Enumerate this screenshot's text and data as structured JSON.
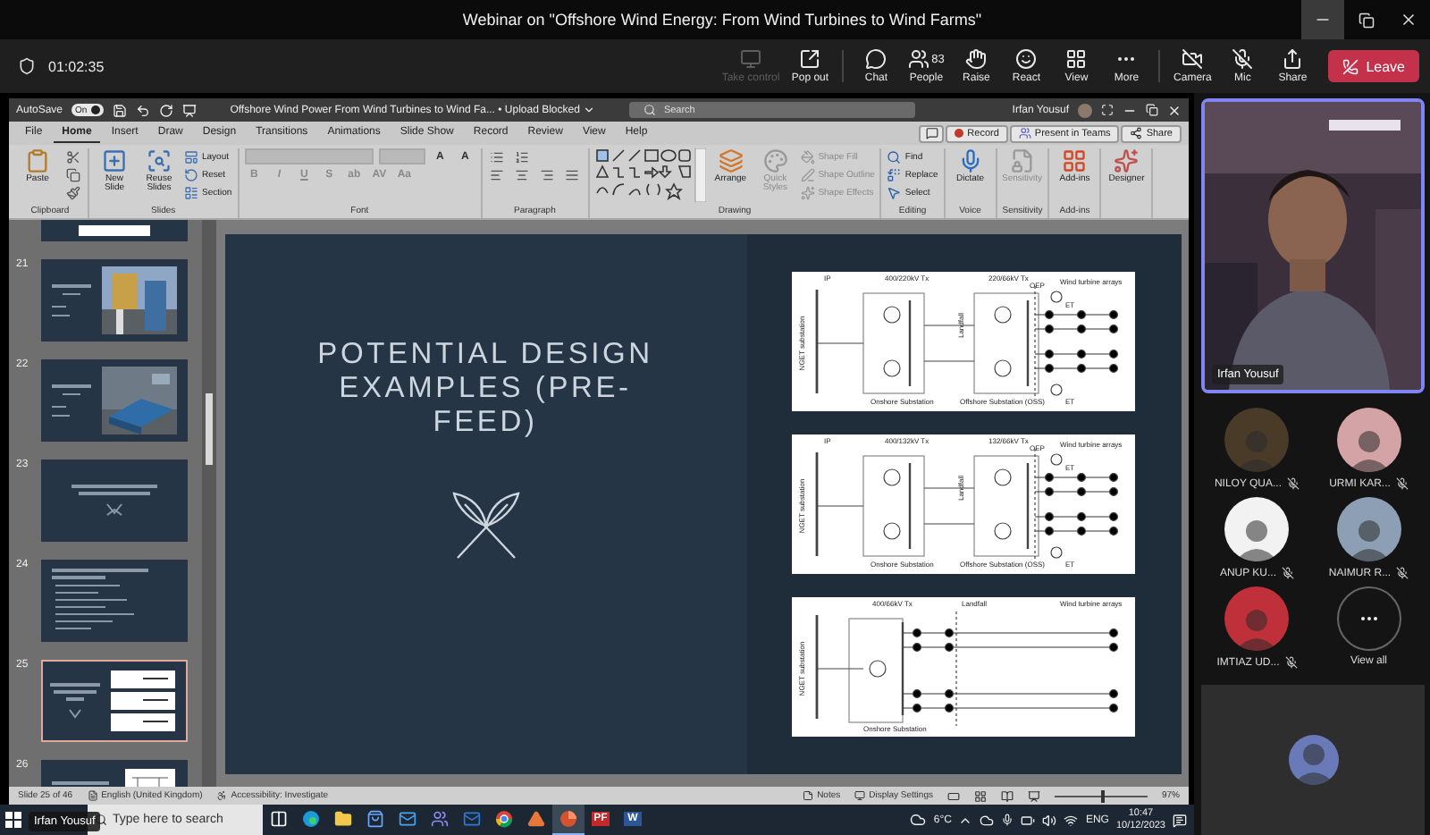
{
  "meeting": {
    "title": "Webinar on \"Offshore Wind Energy: From Wind Turbines to Wind Farms\"",
    "timer": "01:02:35",
    "controls": [
      {
        "label": "Take control",
        "kind": "take-control",
        "disabled": true
      },
      {
        "label": "Pop out",
        "kind": "pop-out",
        "disabled": false
      },
      {
        "label": "Chat",
        "kind": "chat",
        "disabled": false
      },
      {
        "label": "People",
        "kind": "people",
        "disabled": false,
        "count": "83"
      },
      {
        "label": "Raise",
        "kind": "raise",
        "disabled": false
      },
      {
        "label": "React",
        "kind": "react",
        "disabled": false
      },
      {
        "label": "View",
        "kind": "view",
        "disabled": false
      },
      {
        "label": "More",
        "kind": "more",
        "disabled": false
      },
      {
        "label": "Camera",
        "kind": "camera",
        "disabled": false,
        "on": false
      },
      {
        "label": "Mic",
        "kind": "mic",
        "disabled": false,
        "on": false
      },
      {
        "label": "Share",
        "kind": "share",
        "disabled": false
      }
    ],
    "leave": "Leave"
  },
  "powerpoint": {
    "autosave": {
      "label": "AutoSave",
      "state": "On",
      "on": true
    },
    "file_title": "Offshore Wind Power From Wind Turbines to Wind Fa... • Upload Blocked",
    "search": {
      "placeholder": "Search"
    },
    "user": "Irfan Yousuf",
    "tabs": [
      {
        "label": "File",
        "selected": false
      },
      {
        "label": "Home",
        "selected": true
      },
      {
        "label": "Insert",
        "selected": false
      },
      {
        "label": "Draw",
        "selected": false
      },
      {
        "label": "Design",
        "selected": false
      },
      {
        "label": "Transitions",
        "selected": false
      },
      {
        "label": "Animations",
        "selected": false
      },
      {
        "label": "Slide Show",
        "selected": false
      },
      {
        "label": "Record",
        "selected": false
      },
      {
        "label": "Review",
        "selected": false
      },
      {
        "label": "View",
        "selected": false
      },
      {
        "label": "Help",
        "selected": false
      }
    ],
    "header_buttons": [
      "Record",
      "Present in Teams",
      "Share"
    ],
    "ribbon": [
      {
        "kind": "clipboard",
        "name": "Clipboard",
        "items": [
          {
            "label": "Paste",
            "kind": "large",
            "disabled": false
          }
        ]
      },
      {
        "kind": "slides",
        "name": "Slides",
        "items": [
          {
            "label": "New Slide",
            "kind": "large",
            "disabled": false
          },
          {
            "label": "Reuse Slides",
            "kind": "large",
            "disabled": false
          },
          {
            "label": "Layout",
            "kind": "small",
            "disabled": false
          },
          {
            "label": "Reset",
            "kind": "small",
            "disabled": false
          },
          {
            "label": "Section",
            "kind": "small",
            "disabled": false
          }
        ]
      },
      {
        "kind": "font",
        "name": "Font",
        "items": [
          {
            "label": "B",
            "kind": "format",
            "disabled": true
          },
          {
            "label": "I",
            "kind": "format",
            "disabled": true
          },
          {
            "label": "U",
            "kind": "format",
            "disabled": true
          },
          {
            "label": "S",
            "kind": "format",
            "disabled": true
          },
          {
            "label": "ab",
            "kind": "format",
            "disabled": true
          },
          {
            "label": "AV",
            "kind": "format",
            "disabled": true
          },
          {
            "label": "Aa",
            "kind": "format",
            "disabled": true
          },
          {
            "label": "A",
            "kind": "format",
            "disabled": false
          },
          {
            "label": "A",
            "kind": "format",
            "disabled": false
          }
        ]
      },
      {
        "kind": "paragraph",
        "name": "Paragraph"
      },
      {
        "kind": "drawing",
        "name": "Drawing",
        "items": [
          {
            "label": "Arrange",
            "kind": "large",
            "disabled": false
          },
          {
            "label": "Quick Styles",
            "kind": "large",
            "disabled": true
          },
          {
            "label": "Shape Fill",
            "kind": "small",
            "disabled": true
          },
          {
            "label": "Shape Outline",
            "kind": "small",
            "disabled": true
          },
          {
            "label": "Shape Effects",
            "kind": "small",
            "disabled": true
          }
        ]
      },
      {
        "kind": "editing",
        "name": "Editing",
        "items": [
          {
            "label": "Find",
            "kind": "small",
            "disabled": false
          },
          {
            "label": "Replace",
            "kind": "small",
            "disabled": false
          },
          {
            "label": "Select",
            "kind": "small",
            "disabled": false
          }
        ]
      },
      {
        "kind": "voice",
        "name": "Voice",
        "items": [
          {
            "label": "Dictate",
            "kind": "large",
            "disabled": false
          }
        ]
      },
      {
        "kind": "sensitivity",
        "name": "Sensitivity",
        "items": [
          {
            "label": "Sensitivity",
            "kind": "large",
            "disabled": true
          }
        ]
      },
      {
        "kind": "addins",
        "name": "Add-ins",
        "items": [
          {
            "label": "Add-ins",
            "kind": "large",
            "disabled": false
          }
        ]
      },
      {
        "kind": "designer",
        "items": [
          {
            "label": "Designer",
            "kind": "large",
            "disabled": false
          }
        ]
      }
    ],
    "thumbnails": [
      {
        "kind": "cut-off",
        "selected": false
      },
      {
        "number": "21",
        "selected": false
      },
      {
        "number": "22",
        "selected": false
      },
      {
        "number": "23",
        "kind": "title",
        "selected": false
      },
      {
        "number": "24",
        "kind": "list",
        "selected": false
      },
      {
        "number": "25",
        "kind": "diagrams",
        "selected": true
      },
      {
        "number": "26",
        "kind": "text-diagram",
        "selected": false
      }
    ],
    "slide": {
      "title": "POTENTIAL DESIGN EXAMPLES (PRE-FEED)",
      "diagrams": [
        {
          "kind": "two-substation",
          "labels": [
            "IP",
            "400/220kV Tx",
            "220/66kV Tx",
            "OEP",
            "Wind turbine arrays",
            "ET",
            "Landfall",
            "NGET substation",
            "Onshore Substation",
            "Offshore Substation (OSS)",
            "ET"
          ]
        },
        {
          "kind": "two-substation",
          "labels": [
            "IP",
            "400/132kV Tx",
            "132/66kV Tx",
            "OEP",
            "Wind turbine arrays",
            "ET",
            "Landfall",
            "NGET substation",
            "Onshore Substation",
            "Offshore Substation (OSS)",
            "ET"
          ]
        },
        {
          "kind": "landfall",
          "labels": [
            "400/66kV Tx",
            "Landfall",
            "Wind turbine arrays",
            "NGET substation",
            "Onshore Substation"
          ]
        }
      ]
    },
    "status_bar": {
      "slide": "Slide 25 of 46",
      "language": "English (United Kingdom)",
      "accessibility": "Accessibility: Investigate",
      "notes": "Notes",
      "display": "Display Settings",
      "zoom": {
        "label": "97%",
        "level": 0.5
      }
    }
  },
  "presenter_label": "Irfan Yousuf",
  "taskbar": {
    "search": {
      "placeholder": "Type here to search"
    },
    "apps": [
      {
        "kind": "task-view",
        "active": false
      },
      {
        "kind": "edge",
        "active": false
      },
      {
        "kind": "explorer",
        "active": false
      },
      {
        "kind": "store",
        "active": false
      },
      {
        "kind": "mail",
        "active": false
      },
      {
        "kind": "teams",
        "active": false
      },
      {
        "kind": "outlook",
        "active": false
      },
      {
        "kind": "chrome",
        "active": false
      },
      {
        "kind": "matlab",
        "active": false
      },
      {
        "kind": "powerpoint",
        "active": true
      },
      {
        "kind": "pdf",
        "active": false,
        "glyph": "PF"
      },
      {
        "kind": "word",
        "active": false,
        "glyph": "W"
      }
    ],
    "temperature": "6°C",
    "language": "ENG",
    "time": "10:47",
    "date": "10/12/2023"
  },
  "side_panel": {
    "speaker": "Irfan Yousuf",
    "participants": [
      {
        "name": "NILOY QUA...",
        "muted": true
      },
      {
        "name": "URMI KAR...",
        "muted": true
      },
      {
        "name": "ANUP KU...",
        "muted": true
      },
      {
        "name": "NAIMUR R...",
        "muted": true
      },
      {
        "name": "IMTIAZ UD...",
        "muted": true
      }
    ],
    "view_all": "View all"
  }
}
